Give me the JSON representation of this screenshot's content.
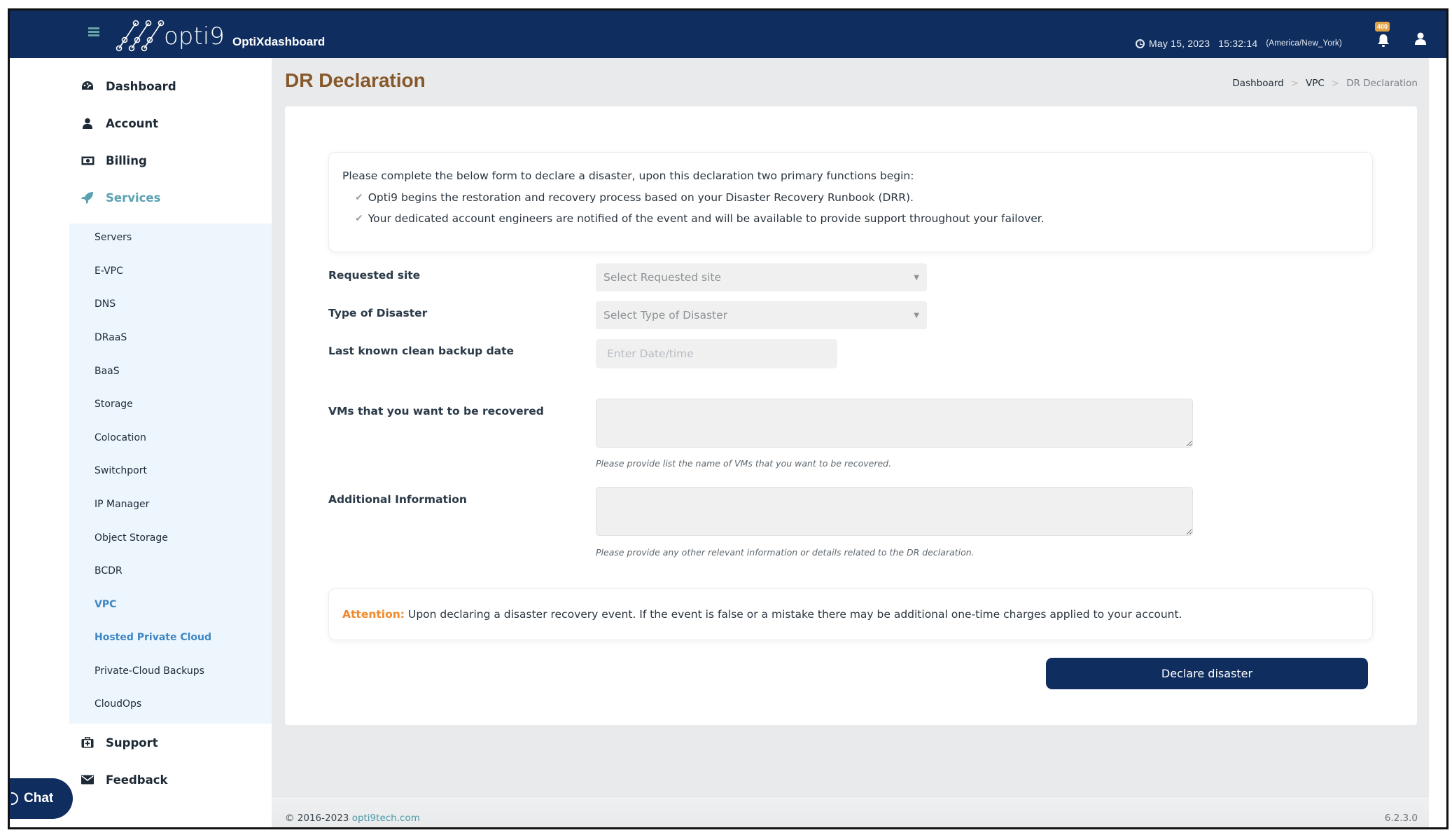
{
  "header": {
    "brand_logo_text": "opti9",
    "app_name": "OptiXdashboard",
    "date": "May 15, 2023",
    "time": "15:32:14",
    "timezone": "(America/New_York)",
    "notification_count": "400",
    "colors": {
      "navbar": "#0f2d5e",
      "badge": "#e0a44a"
    }
  },
  "sidebar": {
    "items": [
      {
        "label": "Dashboard",
        "icon": "tachometer-icon"
      },
      {
        "label": "Account",
        "icon": "user-icon"
      },
      {
        "label": "Billing",
        "icon": "money-icon"
      },
      {
        "label": "Services",
        "icon": "rocket-icon",
        "active": true
      },
      {
        "label": "Support",
        "icon": "medkit-icon"
      },
      {
        "label": "Feedback",
        "icon": "envelope-icon"
      }
    ],
    "services_submenu": [
      {
        "label": "Servers"
      },
      {
        "label": "E-VPC"
      },
      {
        "label": "DNS"
      },
      {
        "label": "DRaaS"
      },
      {
        "label": "BaaS"
      },
      {
        "label": "Storage"
      },
      {
        "label": "Colocation"
      },
      {
        "label": "Switchport"
      },
      {
        "label": "IP Manager"
      },
      {
        "label": "Object Storage"
      },
      {
        "label": "BCDR"
      },
      {
        "label": "VPC",
        "highlighted": true
      },
      {
        "label": "Hosted Private Cloud",
        "highlighted": true
      },
      {
        "label": "Private-Cloud Backups"
      },
      {
        "label": "CloudOps"
      }
    ],
    "chat_label": "Chat"
  },
  "page": {
    "title": "DR Declaration",
    "breadcrumb": [
      {
        "label": "Dashboard"
      },
      {
        "label": "VPC"
      },
      {
        "label": "DR Declaration",
        "current": true
      }
    ],
    "breadcrumb_separator": ">"
  },
  "info_box": {
    "intro": "Please complete the below form to declare a disaster, upon this declaration two primary functions begin:",
    "points": [
      "Opti9 begins the restoration and recovery process based on your Disaster Recovery Runbook (DRR).",
      "Your dedicated account engineers are notified of the event and will be available to provide support throughout your failover."
    ]
  },
  "form": {
    "requested_site": {
      "label": "Requested site",
      "placeholder": "Select Requested site"
    },
    "disaster_type": {
      "label": "Type of Disaster",
      "placeholder": "Select Type of Disaster"
    },
    "backup_date": {
      "label": "Last known clean backup date",
      "placeholder": "Enter Date/time",
      "value": ""
    },
    "vms": {
      "label": "VMs that you want to be recovered",
      "value": "",
      "help": "Please provide list the name of VMs that you want to be recovered."
    },
    "additional": {
      "label": "Additional Information",
      "value": "",
      "help": "Please provide any other relevant information or details related to the DR declaration."
    }
  },
  "attention": {
    "prefix": "Attention:",
    "text": "Upon declaring a disaster recovery event. If the event is false or a mistake there may be additional one-time charges applied to your account.",
    "color": "#ef8a2c"
  },
  "actions": {
    "declare_label": "Declare disaster"
  },
  "footer": {
    "copyright": "© 2016-2023",
    "link_text": "opti9tech.com",
    "version": "6.2.3.0"
  }
}
